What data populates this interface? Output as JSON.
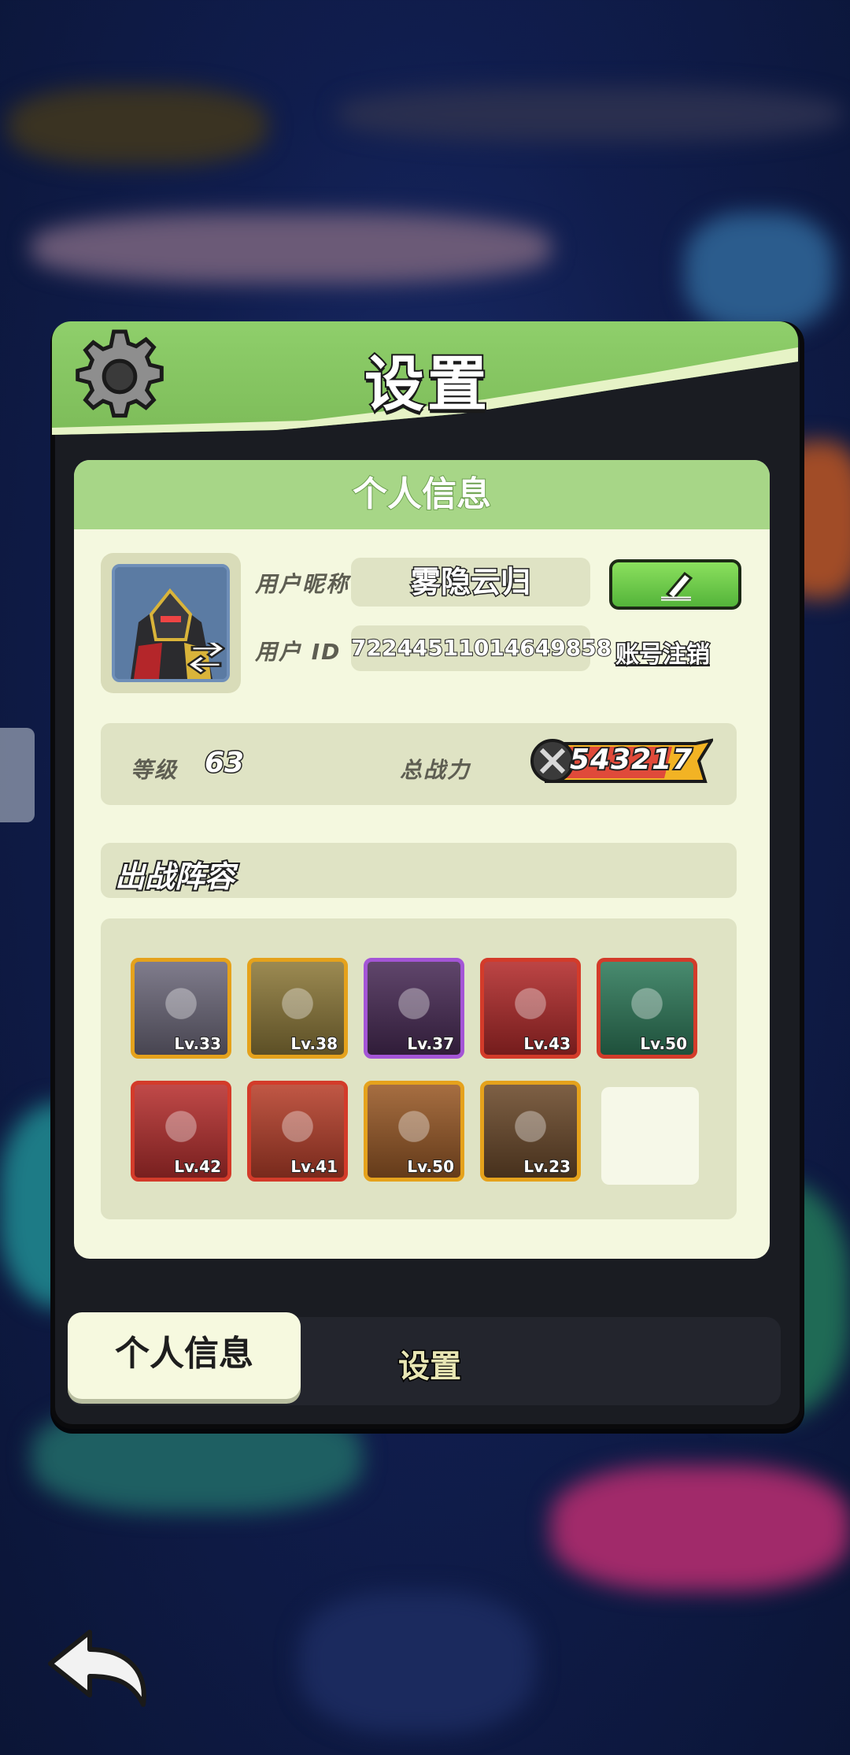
{
  "dialog": {
    "title": "设置",
    "section_title": "个人信息"
  },
  "profile": {
    "nickname_label": "用户昵称",
    "nickname": "雾隐云归",
    "id_label": "用户  ID",
    "user_id": "7224451101464985 8",
    "user_id_display": "72244511014649858",
    "delete_account_label": "账号注销",
    "level_label": "等级",
    "level": "63",
    "power_label": "总战力",
    "power": "543217"
  },
  "lineup": {
    "title": "出战阵容",
    "heroes": [
      {
        "level": "Lv.33",
        "frame": "#e5a21c",
        "bg": "#6e6a7c"
      },
      {
        "level": "Lv.38",
        "frame": "#e5a21c",
        "bg": "#8e7a3a"
      },
      {
        "level": "Lv.37",
        "frame": "#a455d6",
        "bg": "#4a2c57"
      },
      {
        "level": "Lv.43",
        "frame": "#d33b2a",
        "bg": "#b32b2b"
      },
      {
        "level": "Lv.50",
        "frame": "#d33b2a",
        "bg": "#2f7b5b"
      },
      {
        "level": "Lv.42",
        "frame": "#d33b2a",
        "bg": "#b8302f"
      },
      {
        "level": "Lv.41",
        "frame": "#d33b2a",
        "bg": "#b8402b"
      },
      {
        "level": "Lv.50",
        "frame": "#e5a21c",
        "bg": "#9a5a27"
      },
      {
        "level": "Lv.23",
        "frame": "#e5a21c",
        "bg": "#6c4a2b"
      }
    ]
  },
  "tabs": {
    "profile": "个人信息",
    "settings": "设置"
  },
  "icons": {
    "gear": "gear-icon",
    "edit": "pencil-icon",
    "back": "back-arrow-icon",
    "swap": "swap-icon",
    "power": "crossed-swords-icon"
  },
  "colors": {
    "header_green": "#8fcf6b",
    "card_bg": "#f4f8df",
    "button_green": "#54b43a"
  }
}
